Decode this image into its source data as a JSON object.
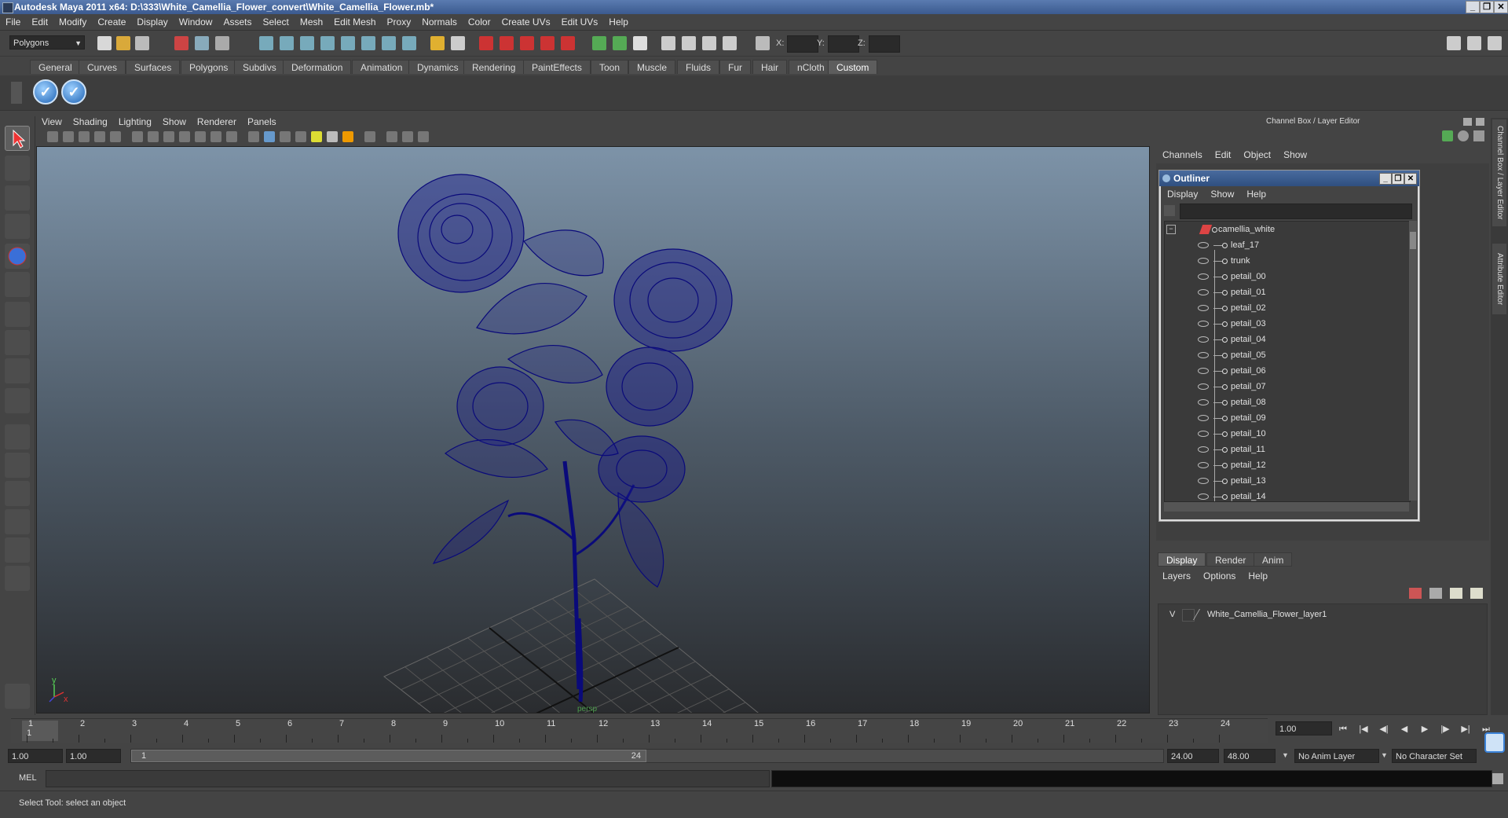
{
  "app": {
    "title": "Autodesk Maya 2011 x64: D:\\333\\White_Camellia_Flower_convert\\White_Camellia_Flower.mb*",
    "minimize_icon": "minimize-icon",
    "restore_icon": "restore-icon",
    "close_icon": "close-icon"
  },
  "menubar": [
    "File",
    "Edit",
    "Modify",
    "Create",
    "Display",
    "Window",
    "Assets",
    "Select",
    "Mesh",
    "Edit Mesh",
    "Proxy",
    "Normals",
    "Color",
    "Create UVs",
    "Edit UVs",
    "Help"
  ],
  "toolbar": {
    "mode": "Polygons",
    "x_label": "X:",
    "y_label": "Y:",
    "z_label": "Z:"
  },
  "shelf": {
    "tabs": [
      "General",
      "Curves",
      "Surfaces",
      "Polygons",
      "Subdivs",
      "Deformation",
      "Animation",
      "Dynamics",
      "Rendering",
      "PaintEffects",
      "Toon",
      "Muscle",
      "Fluids",
      "Fur",
      "Hair",
      "nCloth",
      "Custom"
    ],
    "active_tab": "Custom",
    "buttons": [
      "check-icon",
      "check-icon"
    ]
  },
  "viewport": {
    "menu": [
      "View",
      "Shading",
      "Lighting",
      "Show",
      "Renderer",
      "Panels"
    ],
    "camera_label": "persp",
    "axis_x": "x",
    "axis_y": "y",
    "wire_color": "#0a0a7a"
  },
  "channel_box": {
    "header": "Channel Box / Layer Editor",
    "menu": [
      "Channels",
      "Edit",
      "Object",
      "Show"
    ]
  },
  "outliner": {
    "title": "Outliner",
    "menu": [
      "Display",
      "Show",
      "Help"
    ],
    "root": "camellia_white",
    "items": [
      "leaf_17",
      "trunk",
      "petail_00",
      "petail_01",
      "petail_02",
      "petail_03",
      "petail_04",
      "petail_05",
      "petail_06",
      "petail_07",
      "petail_08",
      "petail_09",
      "petail_10",
      "petail_11",
      "petail_12",
      "petail_13",
      "petail_14"
    ]
  },
  "layer_editor": {
    "tabs": [
      "Display",
      "Render",
      "Anim"
    ],
    "active_tab": "Display",
    "menu": [
      "Layers",
      "Options",
      "Help"
    ],
    "layer": {
      "visible": "V",
      "name": "White_Camellia_Flower_layer1"
    }
  },
  "side_tabs": [
    "Channel Box / Layer Editor",
    "Attribute Editor"
  ],
  "timeline": {
    "ticks": [
      "1",
      "2",
      "3",
      "4",
      "5",
      "6",
      "7",
      "8",
      "9",
      "10",
      "11",
      "12",
      "13",
      "14",
      "15",
      "16",
      "17",
      "18",
      "19",
      "20",
      "21",
      "22",
      "23",
      "24"
    ],
    "current_frame": "1.00",
    "start_marker": "1"
  },
  "range": {
    "start": "1.00",
    "playback_start": "1.00",
    "handle_start": "1",
    "handle_end": "24",
    "playback_end": "24.00",
    "end": "48.00",
    "anim_layer": "No Anim Layer",
    "character_set": "No Character Set"
  },
  "command": {
    "label": "MEL",
    "help": "Select Tool: select an object"
  }
}
